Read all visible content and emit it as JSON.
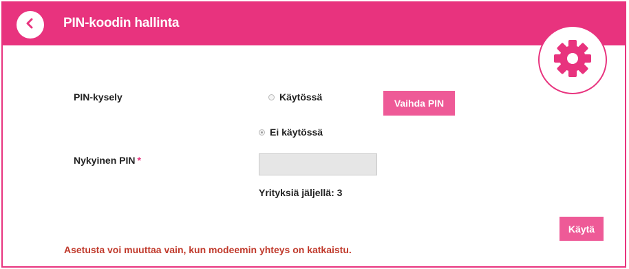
{
  "header": {
    "title": "PIN-koodin hallinta",
    "back_icon": "chevron-left-icon",
    "badge_icon": "gear-icon"
  },
  "colors": {
    "accent": "#e8337e",
    "button": "#ee5a97",
    "notice": "#c0392b"
  },
  "pin_query": {
    "label": "PIN-kysely",
    "options": [
      {
        "label": "Käytössä",
        "checked": false
      },
      {
        "label": "Ei käytössä",
        "checked": true
      }
    ],
    "change_button": "Vaihda PIN"
  },
  "current_pin": {
    "label": "Nykyinen PIN",
    "required_marker": "*",
    "value": "",
    "attempts_text": "Yrityksiä jäljellä: 3"
  },
  "apply_button": "Käytä",
  "notice": "Asetusta voi muuttaa vain, kun modeemin yhteys on katkaistu."
}
